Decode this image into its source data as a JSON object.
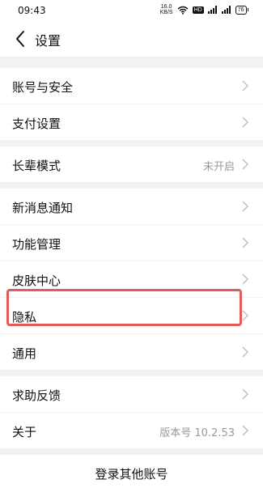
{
  "status_bar": {
    "time": "09:43",
    "net_speed_value": "16.0",
    "net_speed_unit": "KB/S",
    "hd_badge": "HD",
    "battery": "76",
    "icons": [
      "wifi-icon",
      "hd-icon",
      "signal-icon",
      "signal-icon",
      "battery-icon"
    ]
  },
  "nav": {
    "title": "设置",
    "back_icon": "chevron-left-icon"
  },
  "groups": [
    {
      "items": [
        {
          "label": "账号与安全",
          "value": ""
        },
        {
          "label": "支付设置",
          "value": ""
        }
      ]
    },
    {
      "items": [
        {
          "label": "长辈模式",
          "value": "未开启"
        }
      ]
    },
    {
      "items": [
        {
          "label": "新消息通知",
          "value": ""
        },
        {
          "label": "功能管理",
          "value": ""
        },
        {
          "label": "皮肤中心",
          "value": ""
        },
        {
          "label": "隐私",
          "value": ""
        },
        {
          "label": "通用",
          "value": ""
        }
      ]
    },
    {
      "items": [
        {
          "label": "求助反馈",
          "value": ""
        },
        {
          "label": "关于",
          "value": "版本号 10.2.53"
        }
      ]
    }
  ],
  "footer": {
    "login_other": "登录其他账号"
  },
  "colors": {
    "highlight": "#e45b5b",
    "background": "#f2f2f2",
    "secondary_text": "#999999"
  }
}
